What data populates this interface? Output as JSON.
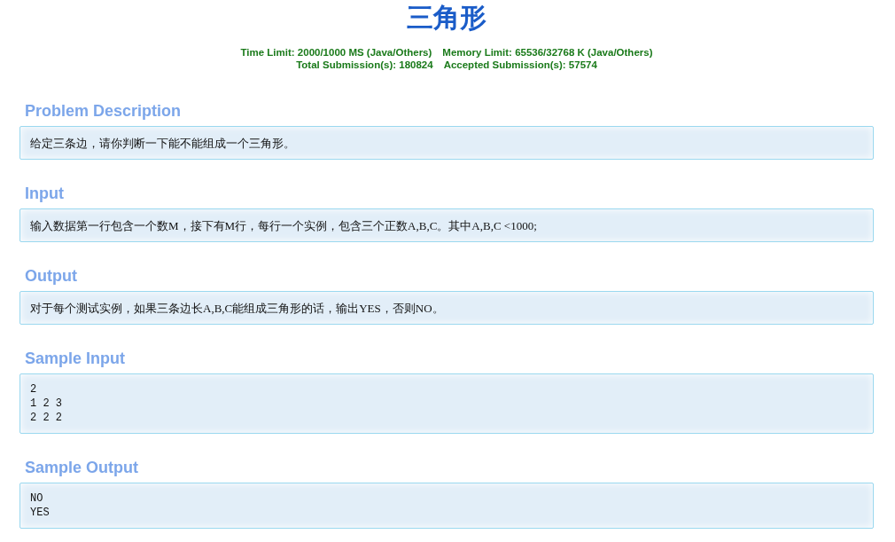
{
  "title": "三角形",
  "limits": [
    "Time Limit: 2000/1000 MS (Java/Others)",
    "Memory Limit: 65536/32768 K (Java/Others)"
  ],
  "stats": [
    "Total Submission(s): 180824",
    "Accepted Submission(s): 57574"
  ],
  "sections": [
    {
      "heading": "Problem Description",
      "kind": "text",
      "content": "给定三条边，请你判断一下能不能组成一个三角形。"
    },
    {
      "heading": "Input",
      "kind": "text",
      "content": "输入数据第一行包含一个数M，接下有M行，每行一个实例，包含三个正数A,B,C。其中A,B,C <1000;"
    },
    {
      "heading": "Output",
      "kind": "text",
      "content": "对于每个测试实例，如果三条边长A,B,C能组成三角形的话，输出YES，否则NO。"
    },
    {
      "heading": "Sample Input",
      "kind": "code",
      "lines": [
        "2",
        "1 2 3",
        "2 2 2"
      ]
    },
    {
      "heading": "Sample Output",
      "kind": "code",
      "lines": [
        "NO",
        "YES"
      ]
    }
  ]
}
